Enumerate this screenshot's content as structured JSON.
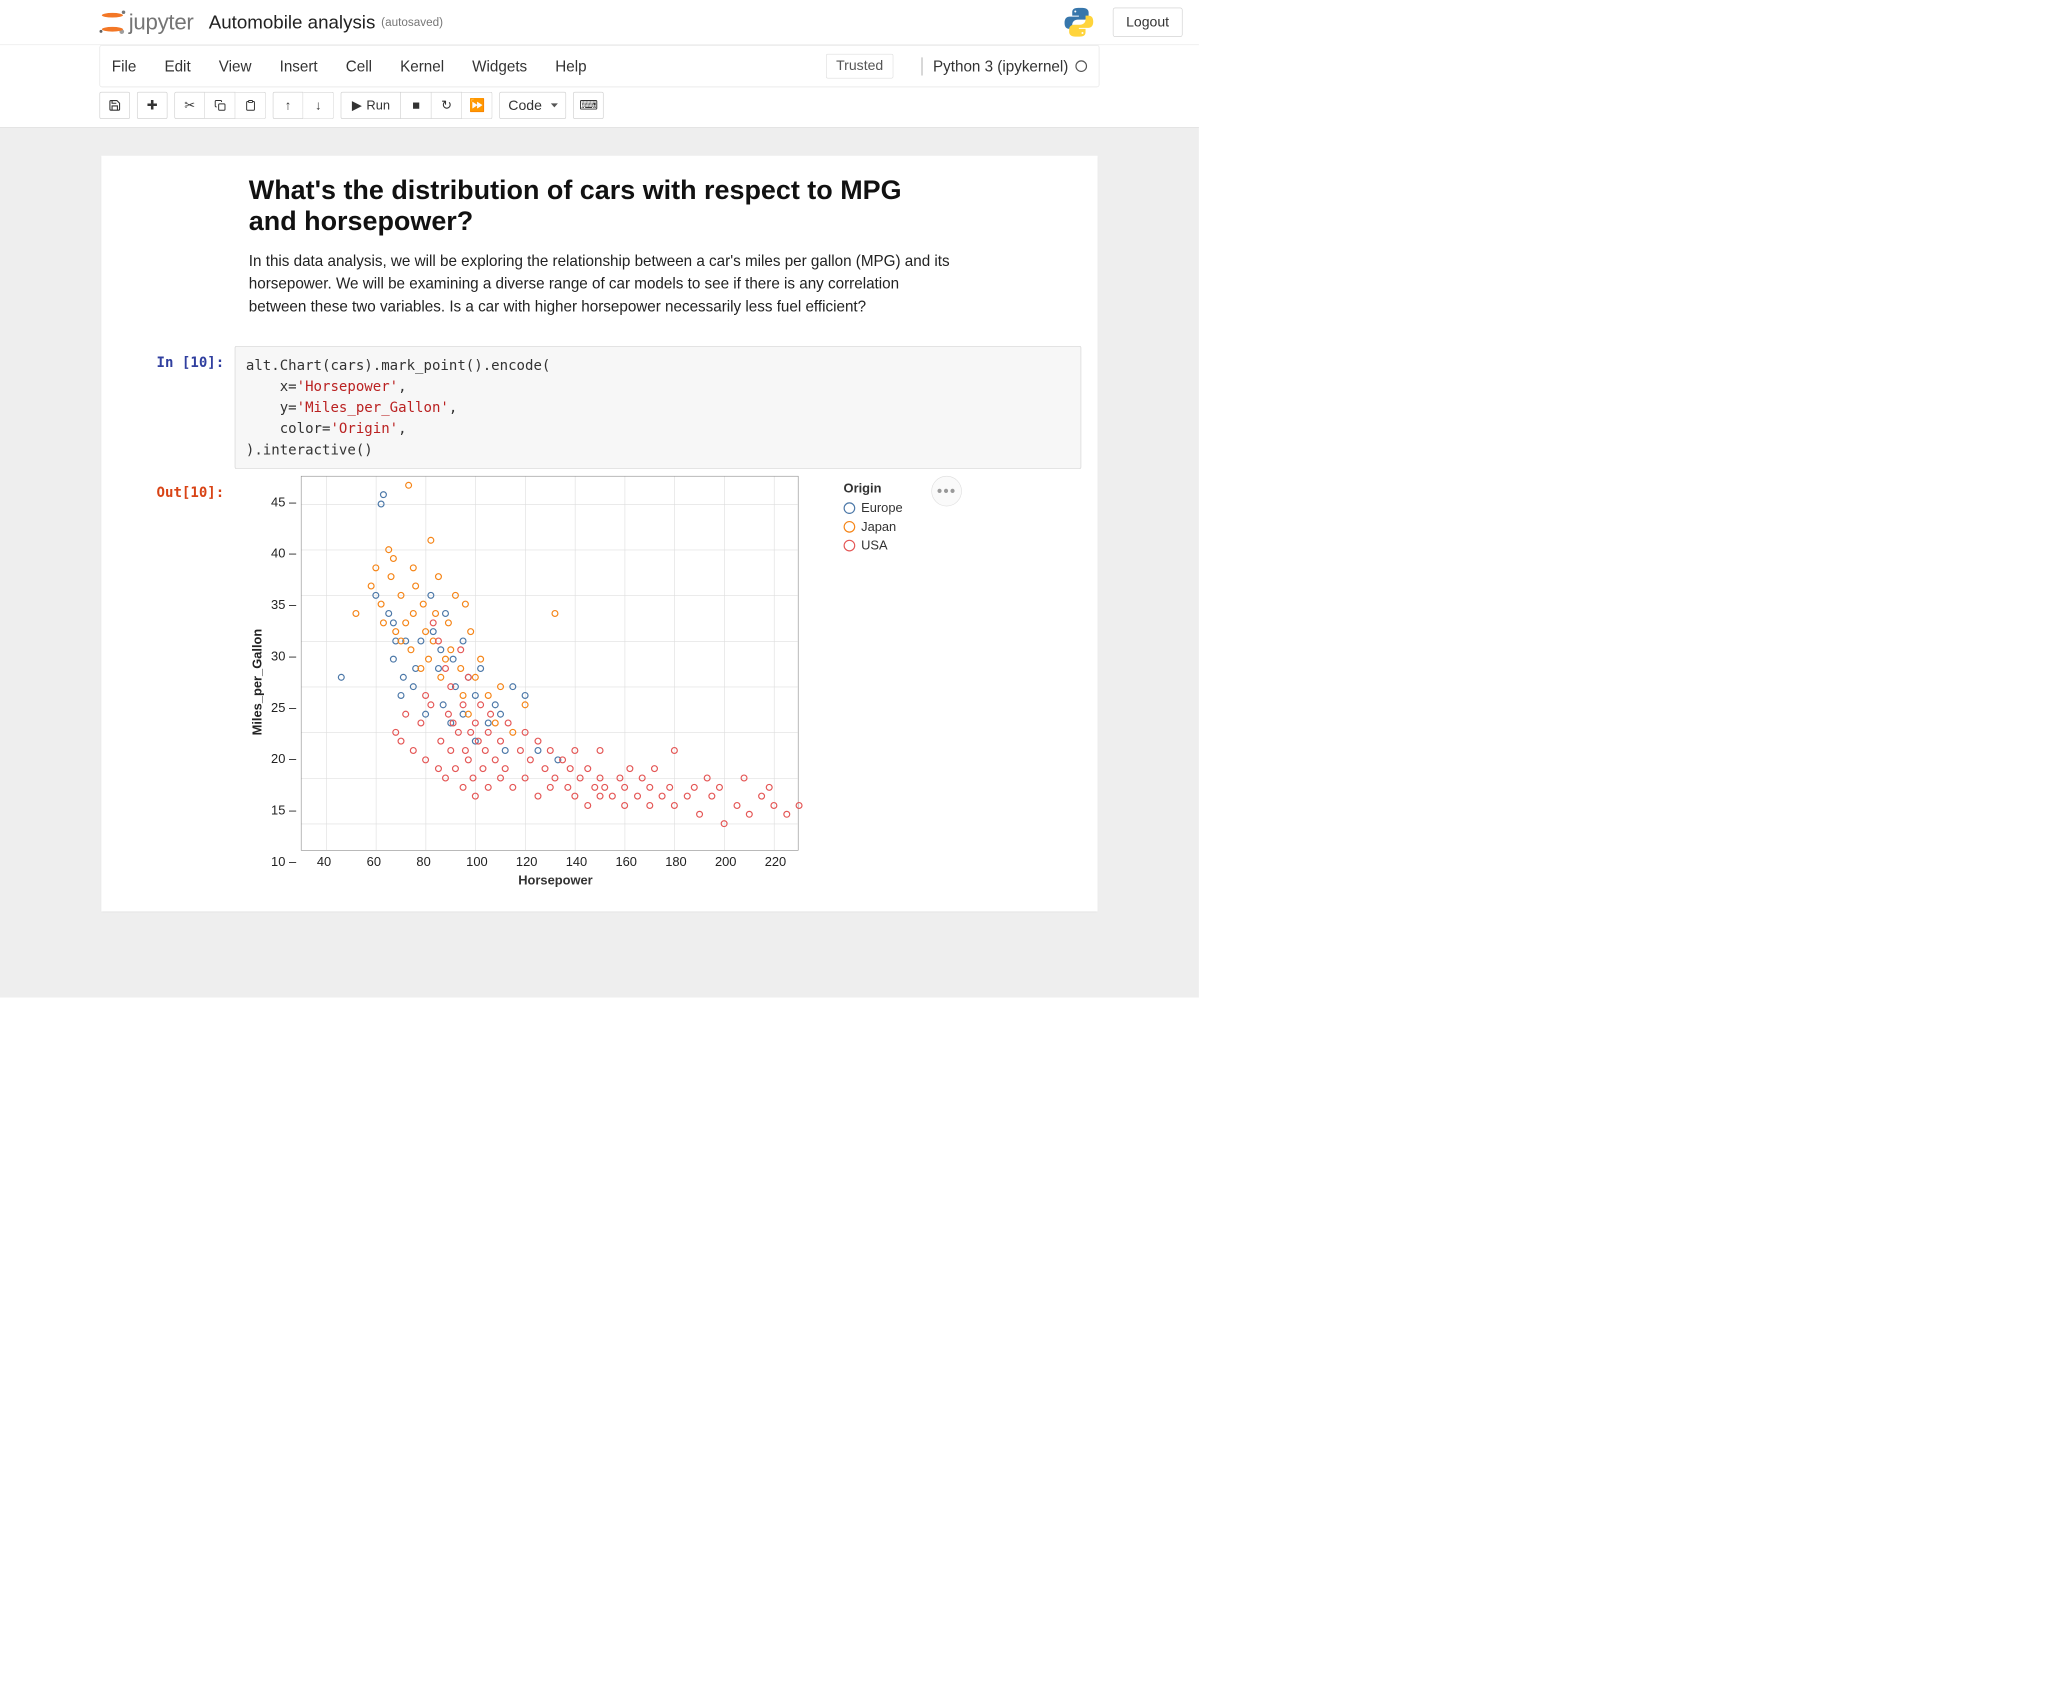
{
  "header": {
    "logo_text": "jupyter",
    "title": "Automobile analysis",
    "autosaved": "(autosaved)",
    "logout": "Logout"
  },
  "menubar": {
    "items": [
      "File",
      "Edit",
      "View",
      "Insert",
      "Cell",
      "Kernel",
      "Widgets",
      "Help"
    ],
    "trusted": "Trusted",
    "kernel": "Python 3 (ipykernel)"
  },
  "toolbar": {
    "run": "Run",
    "celltype": "Code"
  },
  "markdown": {
    "title": "What's the distribution of cars with respect to MPG and horsepower?",
    "body": "In this data analysis, we will be exploring the relationship between a car's miles per gallon (MPG) and its horsepower. We will be examining a diverse range of car models to see if there is any correlation between these two variables. Is a car with higher horsepower necessarily less fuel efficient?"
  },
  "code": {
    "prompt_in": "In [10]:",
    "prompt_out": "Out[10]:",
    "lines": [
      [
        {
          "t": "alt.Chart(cars).mark_point().encode("
        }
      ],
      [
        {
          "t": "    x"
        },
        {
          "t": "=",
          "c": ""
        },
        {
          "t": "'Horsepower'",
          "c": "tok-str"
        },
        {
          "t": ","
        }
      ],
      [
        {
          "t": "    y"
        },
        {
          "t": "=",
          "c": ""
        },
        {
          "t": "'Miles_per_Gallon'",
          "c": "tok-str"
        },
        {
          "t": ","
        }
      ],
      [
        {
          "t": "    color"
        },
        {
          "t": "=",
          "c": ""
        },
        {
          "t": "'Origin'",
          "c": "tok-str"
        },
        {
          "t": ","
        }
      ],
      [
        {
          "t": ").interactive()"
        }
      ]
    ]
  },
  "chart_data": {
    "type": "scatter",
    "xlabel": "Horsepower",
    "ylabel": "Miles_per_Gallon",
    "xticks": [
      40,
      60,
      80,
      100,
      120,
      140,
      160,
      180,
      200,
      220
    ],
    "yticks": [
      45,
      40,
      35,
      30,
      25,
      20,
      15,
      10
    ],
    "xlim": [
      30,
      230
    ],
    "ylim": [
      7,
      48
    ],
    "legend_title": "Origin",
    "series": [
      {
        "name": "Europe",
        "color": "#4c78a8",
        "data": [
          [
            46,
            26
          ],
          [
            60,
            35
          ],
          [
            62,
            45
          ],
          [
            63,
            46
          ],
          [
            65,
            33
          ],
          [
            67,
            28
          ],
          [
            67,
            32
          ],
          [
            68,
            30
          ],
          [
            70,
            24
          ],
          [
            71,
            26
          ],
          [
            72,
            30
          ],
          [
            75,
            25
          ],
          [
            76,
            27
          ],
          [
            78,
            30
          ],
          [
            80,
            22
          ],
          [
            82,
            35
          ],
          [
            83,
            31
          ],
          [
            85,
            27
          ],
          [
            86,
            29
          ],
          [
            87,
            23
          ],
          [
            88,
            33
          ],
          [
            90,
            21
          ],
          [
            91,
            28
          ],
          [
            92,
            25
          ],
          [
            95,
            22
          ],
          [
            95,
            30
          ],
          [
            97,
            26
          ],
          [
            100,
            19
          ],
          [
            100,
            24
          ],
          [
            102,
            27
          ],
          [
            105,
            21
          ],
          [
            108,
            23
          ],
          [
            110,
            22
          ],
          [
            112,
            18
          ],
          [
            115,
            25
          ],
          [
            120,
            24
          ],
          [
            125,
            18
          ],
          [
            133,
            17
          ]
        ]
      },
      {
        "name": "Japan",
        "color": "#f58518",
        "data": [
          [
            52,
            33
          ],
          [
            58,
            36
          ],
          [
            60,
            38
          ],
          [
            62,
            34
          ],
          [
            63,
            32
          ],
          [
            65,
            40
          ],
          [
            66,
            37
          ],
          [
            67,
            39
          ],
          [
            68,
            31
          ],
          [
            70,
            35
          ],
          [
            70,
            30
          ],
          [
            72,
            32
          ],
          [
            73,
            47
          ],
          [
            74,
            29
          ],
          [
            75,
            33
          ],
          [
            75,
            38
          ],
          [
            76,
            36
          ],
          [
            78,
            27
          ],
          [
            79,
            34
          ],
          [
            80,
            31
          ],
          [
            81,
            28
          ],
          [
            82,
            41
          ],
          [
            83,
            30
          ],
          [
            84,
            33
          ],
          [
            85,
            37
          ],
          [
            86,
            26
          ],
          [
            88,
            28
          ],
          [
            89,
            32
          ],
          [
            90,
            29
          ],
          [
            92,
            35
          ],
          [
            94,
            27
          ],
          [
            95,
            24
          ],
          [
            96,
            34
          ],
          [
            97,
            22
          ],
          [
            98,
            31
          ],
          [
            100,
            26
          ],
          [
            102,
            28
          ],
          [
            105,
            24
          ],
          [
            108,
            21
          ],
          [
            110,
            25
          ],
          [
            115,
            20
          ],
          [
            120,
            23
          ],
          [
            132,
            33
          ]
        ]
      },
      {
        "name": "USA",
        "color": "#e45756",
        "data": [
          [
            68,
            20
          ],
          [
            70,
            19
          ],
          [
            72,
            22
          ],
          [
            75,
            18
          ],
          [
            78,
            21
          ],
          [
            80,
            17
          ],
          [
            80,
            24
          ],
          [
            82,
            23
          ],
          [
            83,
            32
          ],
          [
            85,
            16
          ],
          [
            85,
            30
          ],
          [
            86,
            19
          ],
          [
            88,
            27
          ],
          [
            88,
            15
          ],
          [
            89,
            22
          ],
          [
            90,
            18
          ],
          [
            90,
            25
          ],
          [
            91,
            21
          ],
          [
            92,
            16
          ],
          [
            93,
            20
          ],
          [
            94,
            29
          ],
          [
            95,
            14
          ],
          [
            95,
            23
          ],
          [
            96,
            18
          ],
          [
            97,
            26
          ],
          [
            97,
            17
          ],
          [
            98,
            20
          ],
          [
            99,
            15
          ],
          [
            100,
            21
          ],
          [
            100,
            13
          ],
          [
            101,
            19
          ],
          [
            102,
            23
          ],
          [
            103,
            16
          ],
          [
            104,
            18
          ],
          [
            105,
            20
          ],
          [
            105,
            14
          ],
          [
            106,
            22
          ],
          [
            108,
            17
          ],
          [
            110,
            15
          ],
          [
            110,
            19
          ],
          [
            112,
            16
          ],
          [
            113,
            21
          ],
          [
            115,
            14
          ],
          [
            118,
            18
          ],
          [
            120,
            15
          ],
          [
            120,
            20
          ],
          [
            122,
            17
          ],
          [
            125,
            13
          ],
          [
            125,
            19
          ],
          [
            128,
            16
          ],
          [
            130,
            14
          ],
          [
            130,
            18
          ],
          [
            132,
            15
          ],
          [
            135,
            17
          ],
          [
            137,
            14
          ],
          [
            138,
            16
          ],
          [
            140,
            13
          ],
          [
            140,
            18
          ],
          [
            142,
            15
          ],
          [
            145,
            12
          ],
          [
            145,
            16
          ],
          [
            148,
            14
          ],
          [
            150,
            13
          ],
          [
            150,
            15
          ],
          [
            150,
            18
          ],
          [
            152,
            14
          ],
          [
            155,
            13
          ],
          [
            158,
            15
          ],
          [
            160,
            12
          ],
          [
            160,
            14
          ],
          [
            162,
            16
          ],
          [
            165,
            13
          ],
          [
            167,
            15
          ],
          [
            170,
            12
          ],
          [
            170,
            14
          ],
          [
            172,
            16
          ],
          [
            175,
            13
          ],
          [
            178,
            14
          ],
          [
            180,
            12
          ],
          [
            180,
            18
          ],
          [
            185,
            13
          ],
          [
            188,
            14
          ],
          [
            190,
            11
          ],
          [
            193,
            15
          ],
          [
            195,
            13
          ],
          [
            198,
            14
          ],
          [
            200,
            10
          ],
          [
            205,
            12
          ],
          [
            208,
            15
          ],
          [
            210,
            11
          ],
          [
            215,
            13
          ],
          [
            218,
            14
          ],
          [
            220,
            12
          ],
          [
            225,
            11
          ],
          [
            230,
            12
          ]
        ]
      }
    ]
  }
}
